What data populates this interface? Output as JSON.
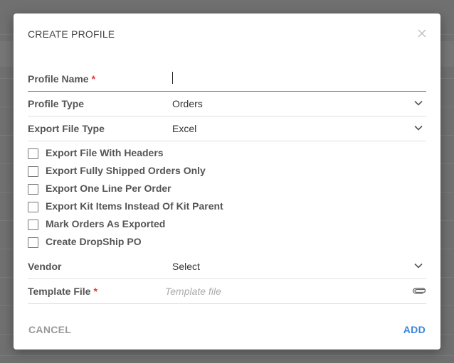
{
  "dialog": {
    "title": "CREATE PROFILE",
    "close_icon": "close-icon"
  },
  "fields": {
    "profile_name": {
      "label": "Profile Name",
      "required": "*",
      "value": ""
    },
    "profile_type": {
      "label": "Profile Type",
      "value": "Orders",
      "icon": "chevron-down-icon"
    },
    "export_file_type": {
      "label": "Export File Type",
      "value": "Excel",
      "icon": "chevron-down-icon"
    },
    "vendor": {
      "label": "Vendor",
      "value": "Select",
      "icon": "chevron-down-icon"
    },
    "template_file": {
      "label": "Template File",
      "required": "*",
      "placeholder": "Template file",
      "icon": "paperclip-icon"
    }
  },
  "checkboxes": [
    {
      "label": "Export File With Headers",
      "checked": false
    },
    {
      "label": "Export Fully Shipped Orders Only",
      "checked": false
    },
    {
      "label": "Export One Line Per Order",
      "checked": false
    },
    {
      "label": "Export Kit Items Instead Of Kit Parent",
      "checked": false
    },
    {
      "label": "Mark Orders As Exported",
      "checked": false
    },
    {
      "label": "Create DropShip PO",
      "checked": false
    }
  ],
  "footer": {
    "cancel_label": "CANCEL",
    "add_label": "ADD"
  },
  "colors": {
    "accent": "#3a86d8",
    "required": "#e53935",
    "active_underline": "#4a7fb5"
  }
}
